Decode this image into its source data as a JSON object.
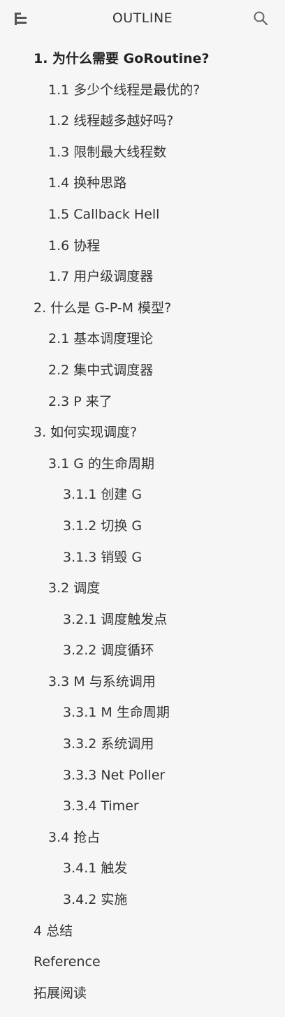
{
  "header": {
    "title": "OUTLINE",
    "left_icon": "outline-list-icon",
    "right_icon": "search-icon"
  },
  "items": [
    {
      "label": "1. 为什么需要 GoRoutine?",
      "level": 1,
      "active": true
    },
    {
      "label": "1.1 多少个线程是最优的?",
      "level": 2
    },
    {
      "label": "1.2 线程越多越好吗?",
      "level": 2
    },
    {
      "label": "1.3 限制最大线程数",
      "level": 2
    },
    {
      "label": "1.4 换种思路",
      "level": 2
    },
    {
      "label": "1.5 Callback Hell",
      "level": 2
    },
    {
      "label": "1.6 协程",
      "level": 2
    },
    {
      "label": "1.7 用户级调度器",
      "level": 2
    },
    {
      "label": "2. 什么是 G-P-M 模型?",
      "level": 1
    },
    {
      "label": "2.1 基本调度理论",
      "level": 2
    },
    {
      "label": "2.2 集中式调度器",
      "level": 2
    },
    {
      "label": "2.3 P 来了",
      "level": 2
    },
    {
      "label": "3. 如何实现调度?",
      "level": 1
    },
    {
      "label": "3.1 G 的生命周期",
      "level": 2
    },
    {
      "label": "3.1.1 创建 G",
      "level": 3
    },
    {
      "label": "3.1.2 切换 G",
      "level": 3
    },
    {
      "label": "3.1.3 销毁 G",
      "level": 3
    },
    {
      "label": "3.2 调度",
      "level": 2
    },
    {
      "label": "3.2.1 调度触发点",
      "level": 3
    },
    {
      "label": "3.2.2 调度循环",
      "level": 3
    },
    {
      "label": "3.3 M 与系统调用",
      "level": 2
    },
    {
      "label": "3.3.1 M 生命周期",
      "level": 3
    },
    {
      "label": "3.3.2 系统调用",
      "level": 3
    },
    {
      "label": "3.3.3 Net Poller",
      "level": 3
    },
    {
      "label": "3.3.4 Timer",
      "level": 3
    },
    {
      "label": "3.4 抢占",
      "level": 2
    },
    {
      "label": "3.4.1 触发",
      "level": 3
    },
    {
      "label": "3.4.2 实施",
      "level": 3
    },
    {
      "label": "4 总结",
      "level": 1
    },
    {
      "label": "Reference",
      "level": 1
    },
    {
      "label": "拓展阅读",
      "level": 1
    }
  ]
}
